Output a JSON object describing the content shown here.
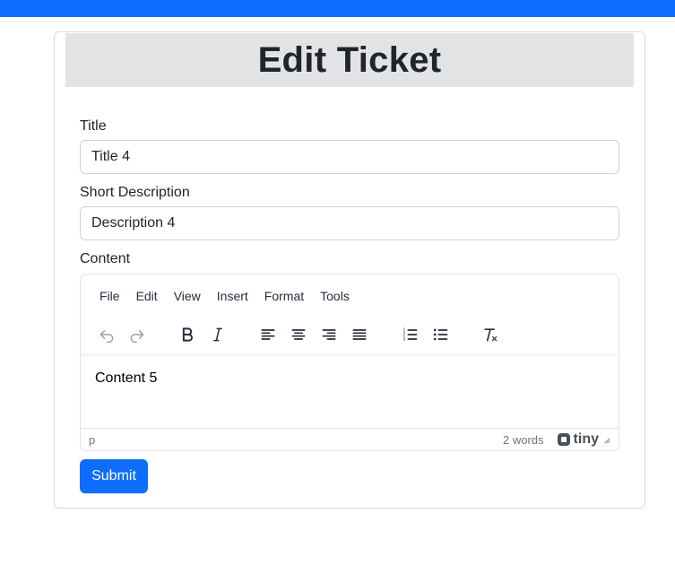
{
  "page": {
    "title": "Edit Ticket",
    "accent_color": "#0d6efd"
  },
  "form": {
    "title_label": "Title",
    "title_value": "Title 4",
    "short_description_label": "Short Description",
    "short_description_value": "Description 4",
    "content_label": "Content",
    "submit_label": "Submit"
  },
  "editor": {
    "menu": [
      "File",
      "Edit",
      "View",
      "Insert",
      "Format",
      "Tools"
    ],
    "toolbar_icons": [
      "undo-icon",
      "redo-icon",
      "bold-icon",
      "italic-icon",
      "align-left-icon",
      "align-center-icon",
      "align-right-icon",
      "align-justify-icon",
      "numbered-list-icon",
      "bullet-list-icon",
      "clear-formatting-icon"
    ],
    "body_text": "Content 5",
    "status_path": "p",
    "word_count": "2 words",
    "brand": "tiny"
  }
}
